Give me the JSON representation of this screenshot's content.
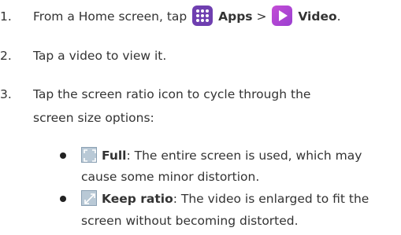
{
  "steps": [
    {
      "number": "1.",
      "text_before": "From a Home screen, tap ",
      "apps_label": "Apps",
      "separator": " > ",
      "video_label": "Video",
      "text_after": "."
    },
    {
      "number": "2.",
      "text": "Tap a video to view it."
    },
    {
      "number": "3.",
      "line1": "Tap the screen ratio icon to cycle through the",
      "line2": "screen size options:"
    }
  ],
  "options": [
    {
      "title": "Full",
      "line1_rest": ": The entire screen is used, which may",
      "line2": "cause some minor distortion.",
      "icon": "full-screen-icon"
    },
    {
      "title": "Keep ratio",
      "line1_rest": ": The video is enlarged to fit the",
      "line2": "screen without becoming distorted.",
      "icon": "keep-ratio-icon"
    }
  ],
  "colors": {
    "apps_icon": "#6f3fb0",
    "video_icon": "#b044d4",
    "ratio_icon": "#b9c9d6"
  }
}
